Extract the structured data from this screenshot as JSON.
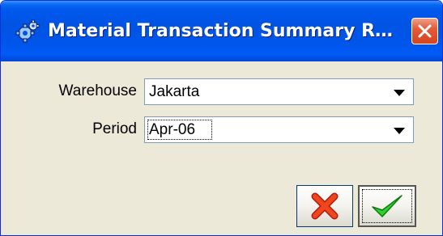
{
  "window": {
    "title": "Material Transaction Summary R…",
    "app_icon": "gears-icon",
    "close_icon": "close-icon"
  },
  "form": {
    "warehouse": {
      "label": "Warehouse",
      "value": "Jakarta"
    },
    "period": {
      "label": "Period",
      "value": "Apr-06"
    }
  },
  "buttons": {
    "cancel_icon": "red-x-icon",
    "ok_icon": "green-check-icon"
  },
  "colors": {
    "titlebar": "#0054e3",
    "body": "#ece9d8",
    "close_button": "#d7431f",
    "cancel_icon": "#e02a10",
    "ok_icon": "#28c328"
  }
}
